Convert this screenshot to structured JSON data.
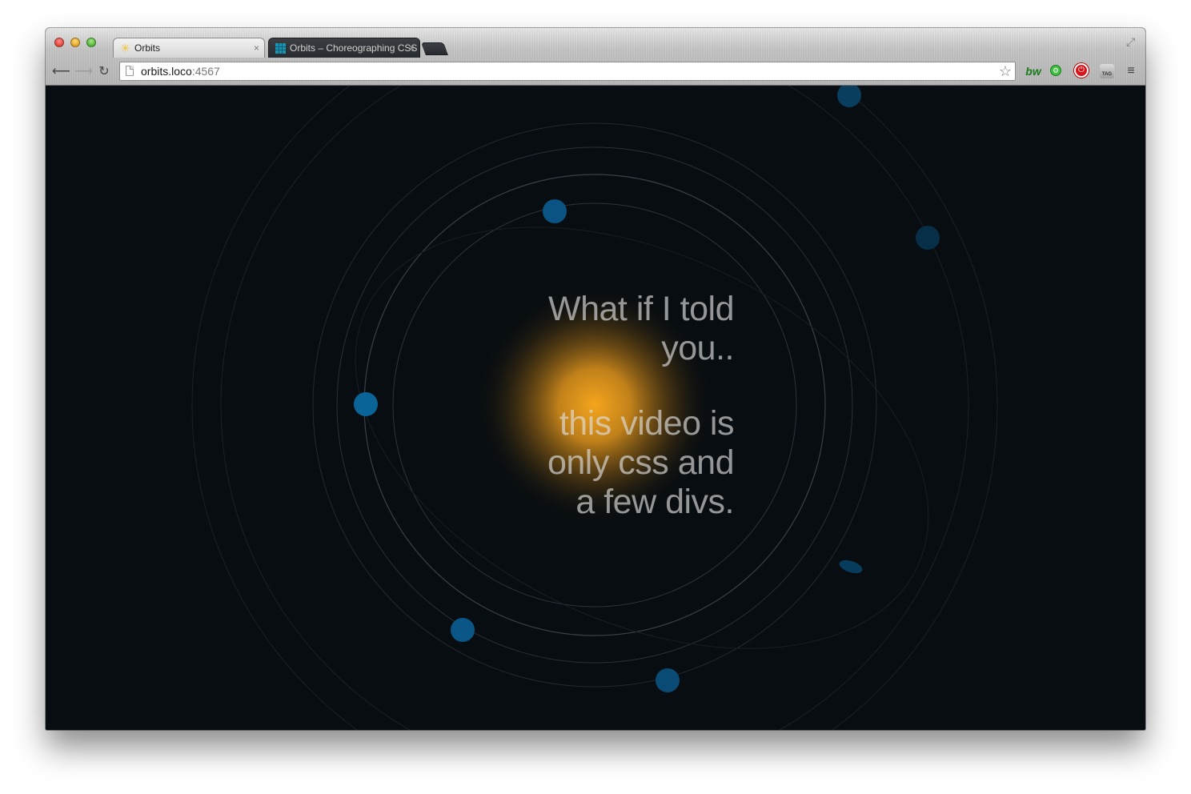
{
  "browser": {
    "tabs": [
      {
        "title": "Orbits",
        "active": true,
        "favicon": "star-icon"
      },
      {
        "title": "Orbits – Choreographing CSS",
        "active": false,
        "favicon": "grid-icon"
      }
    ],
    "tab_close_glyph": "×",
    "url_host": "orbits.loco",
    "url_port": ":4567",
    "extensions": [
      {
        "name": "bw",
        "label": "bw",
        "color": "#1d7a1d"
      },
      {
        "name": "green-extension",
        "label": "⚙",
        "color": "#3cbf3c"
      },
      {
        "name": "red-extension",
        "label": "⏻",
        "color": "#d7141a"
      },
      {
        "name": "tag-extension",
        "label": "TAG",
        "color": "#9d9d9d"
      }
    ]
  },
  "page": {
    "background": "#080d11",
    "message": {
      "line1": "What if I told",
      "line2": "you..",
      "line3": "this video is",
      "line4": "only css and",
      "line5": "a few divs."
    },
    "colors": {
      "sun": "#f0a020",
      "planet": "#0a5f92",
      "orbit": "#2a3038"
    }
  }
}
